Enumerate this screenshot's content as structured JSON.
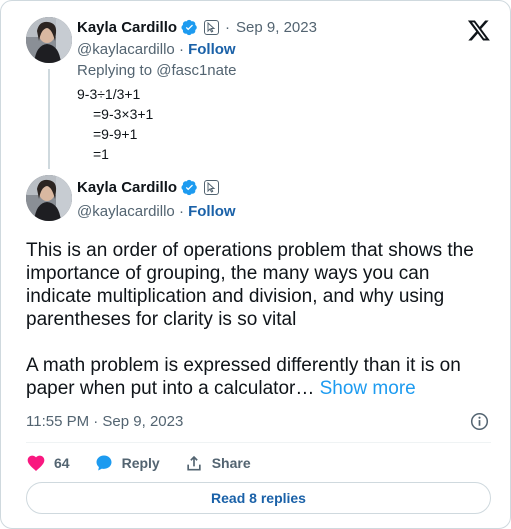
{
  "parent_tweet": {
    "display_name": "Kayla Cardillo",
    "handle": "@kaylacardillo",
    "separator": "·",
    "date": "Sep 9, 2023",
    "follow_label": "Follow",
    "replying_to": "Replying to @fasc1nate",
    "lines": [
      "9-3÷1/3+1",
      "=9-3×3+1",
      "=9-9+1",
      "=1"
    ]
  },
  "main_tweet": {
    "display_name": "Kayla Cardillo",
    "handle": "@kaylacardillo",
    "separator": "·",
    "follow_label": "Follow",
    "paragraph1": "This is an order of operations problem that shows the importance of grouping, the many ways you can indicate multiplication and division, and why using parentheses for clarity is so vital",
    "paragraph2": "A math problem is expressed differently than it is on paper  when put into a calculator…",
    "show_more": "Show more",
    "timestamp": "11:55 PM · Sep 9, 2023"
  },
  "actions": {
    "like_count": "64",
    "reply_label": "Reply",
    "share_label": "Share"
  },
  "read_replies": "Read 8 replies",
  "icons": {
    "verified": "verified-badge-icon",
    "affiliate": "cursor-icon",
    "logo": "x-logo-icon",
    "info": "info-icon",
    "like": "heart-icon",
    "reply": "comment-icon",
    "share": "share-icon"
  },
  "colors": {
    "accent": "#1d9bf0",
    "like": "#f91880",
    "text": "#0f1419",
    "secondary": "#536471"
  }
}
